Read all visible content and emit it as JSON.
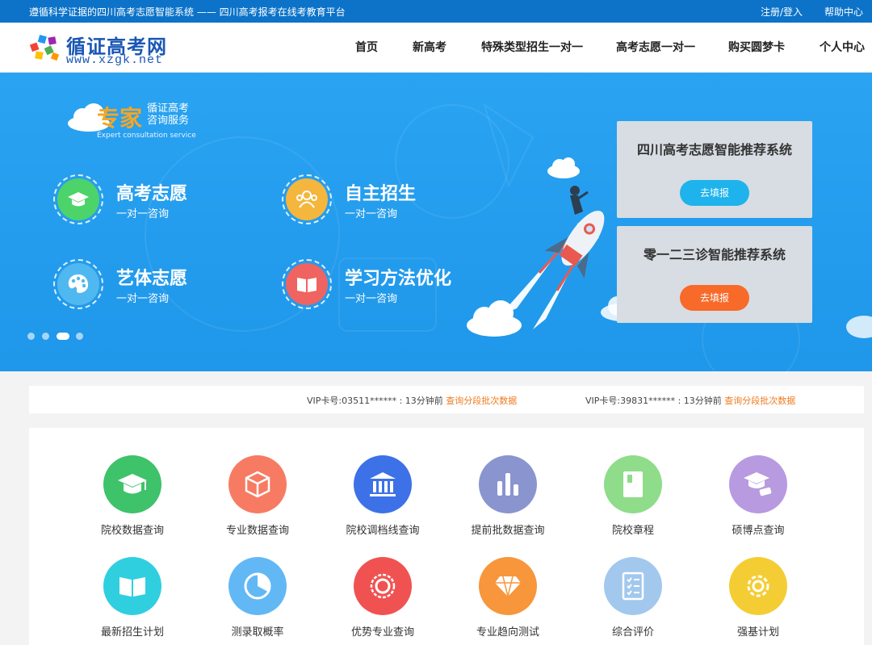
{
  "topbar": {
    "slogan": "遵循科学证据的四川高考志愿智能系统 —— 四川高考报考在线考教育平台",
    "login": "注册/登入",
    "help": "帮助中心"
  },
  "header": {
    "logo_title": "循证高考网",
    "logo_url": "www.xzgk.net",
    "nav": [
      "首页",
      "新高考",
      "特殊类型招生一对一",
      "高考志愿一对一",
      "购买圆梦卡",
      "个人中心"
    ]
  },
  "banner": {
    "expert_big": "专家",
    "expert_small_1": "循证高考",
    "expert_small_2": "咨询服务",
    "expert_en": "Expert consultation service",
    "services": [
      {
        "title": "高考志愿",
        "sub": "一对一咨询",
        "color": "#4cd36a",
        "icon": "graduation-cap-icon"
      },
      {
        "title": "自主招生",
        "sub": "一对一咨询",
        "color": "#f4b63c",
        "icon": "users-icon"
      },
      {
        "title": "艺体志愿",
        "sub": "一对一咨询",
        "color": "#4fb8f0",
        "icon": "palette-icon"
      },
      {
        "title": "学习方法优化",
        "sub": "一对一咨询",
        "color": "#ef6461",
        "icon": "book-icon"
      }
    ],
    "cards": [
      {
        "title": "四川高考志愿智能推荐系统",
        "button": "去填报",
        "button_color": "#1eb3ec"
      },
      {
        "title": "零一二三诊智能推荐系统",
        "button": "去填报",
        "button_color": "#f86a2a"
      }
    ]
  },
  "ticker": [
    {
      "text": "VIP卡号:03511****** :  13分钟前 ",
      "link": "查询分段批次数据"
    },
    {
      "text": "VIP卡号:39831****** :  13分钟前 ",
      "link": "查询分段批次数据"
    }
  ],
  "features": [
    {
      "label": "院校数据查询",
      "color": "#3ec26a",
      "icon": "graduation-cap-icon"
    },
    {
      "label": "专业数据查询",
      "color": "#f77b62",
      "icon": "cube-icon"
    },
    {
      "label": "院校调档线查询",
      "color": "#3d71e8",
      "icon": "institution-icon"
    },
    {
      "label": "提前批数据查询",
      "color": "#8a95cf",
      "icon": "bar-chart-icon"
    },
    {
      "label": "院校章程",
      "color": "#8fdc8a",
      "icon": "document-icon"
    },
    {
      "label": "硕博点查询",
      "color": "#b79ae0",
      "icon": "doctoral-cap-icon"
    },
    {
      "label": "最新招生计划",
      "color": "#2fcfe0",
      "icon": "open-book-icon"
    },
    {
      "label": "测录取概率",
      "color": "#62b8f5",
      "icon": "pie-chart-icon"
    },
    {
      "label": "优势专业查询",
      "color": "#f05252",
      "icon": "badge-icon"
    },
    {
      "label": "专业趋向测试",
      "color": "#f7963a",
      "icon": "diamond-icon"
    },
    {
      "label": "综合评价",
      "color": "#a3c8ee",
      "icon": "checklist-icon"
    },
    {
      "label": "强基计划",
      "color": "#f4cd34",
      "icon": "gear-icon"
    }
  ]
}
